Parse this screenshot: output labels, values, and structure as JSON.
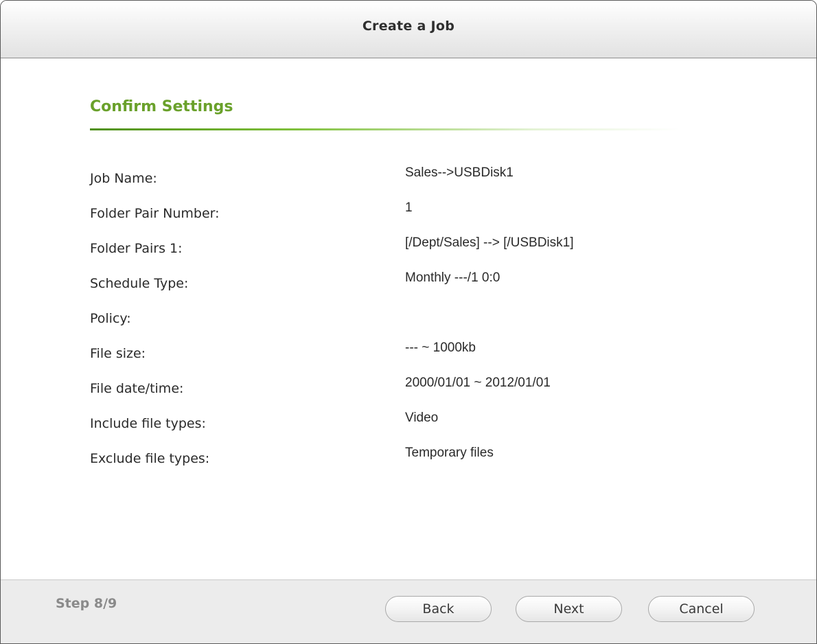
{
  "dialog": {
    "title": "Create a Job"
  },
  "section": {
    "heading": "Confirm Settings"
  },
  "settings": [
    {
      "label": "Job Name:",
      "value": "Sales-->USBDisk1"
    },
    {
      "label": "Folder Pair Number:",
      "value": "1"
    },
    {
      "label": "Folder Pairs 1:",
      "value": "[/Dept/Sales] --> [/USBDisk1]"
    },
    {
      "label": "Schedule Type:",
      "value": "Monthly ---/1 0:0"
    },
    {
      "label": "Policy:",
      "value": ""
    },
    {
      "label": "File size:",
      "value": "--- ~ 1000kb"
    },
    {
      "label": "File date/time:",
      "value": "2000/01/01 ~ 2012/01/01"
    },
    {
      "label": "Include file types:",
      "value": "Video"
    },
    {
      "label": "Exclude file types:",
      "value": "Temporary files"
    }
  ],
  "footer": {
    "step": "Step 8/9",
    "back_label": "Back",
    "next_label": "Next",
    "cancel_label": "Cancel"
  },
  "colors": {
    "accent_green": "#6aa12b",
    "step_text": "#8a8a8a"
  }
}
